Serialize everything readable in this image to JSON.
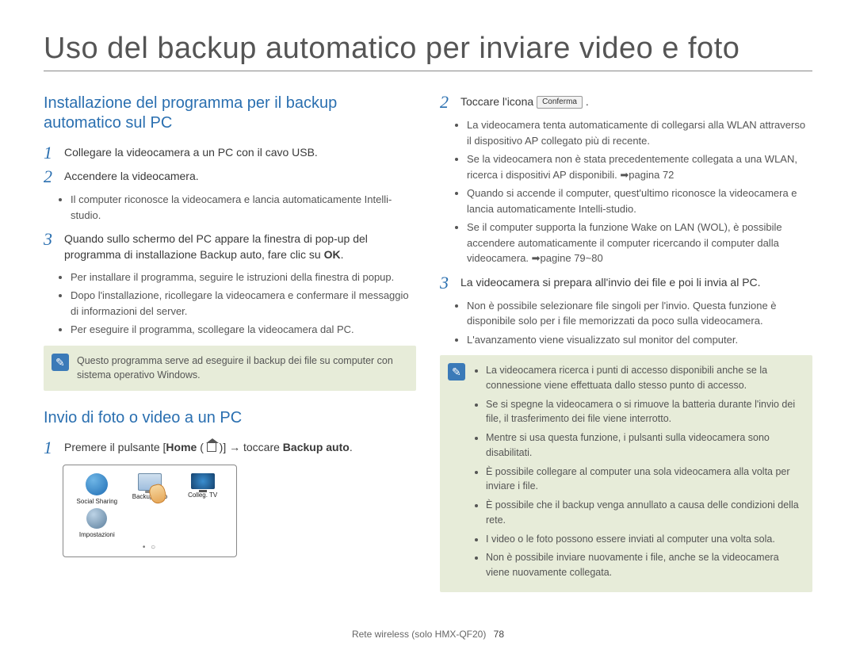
{
  "title": "Uso del backup automatico per inviare video e foto",
  "left": {
    "heading1": "Installazione del programma per il backup automatico sul PC",
    "step1": "Collegare la videocamera a un PC con il cavo USB.",
    "step2": "Accendere la videocamera.",
    "step2_sub1": "Il computer riconosce la videocamera e lancia automaticamente Intelli-studio.",
    "step3_a": "Quando sullo schermo del PC appare la finestra di pop-up del programma di installazione Backup auto, fare clic su ",
    "step3_b": "OK",
    "step3_c": ".",
    "step3_sub1": "Per installare il programma, seguire le istruzioni della finestra di popup.",
    "step3_sub2": "Dopo l'installazione, ricollegare la videocamera e confermare il messaggio di informazioni del server.",
    "step3_sub3": "Per eseguire il programma, scollegare la videocamera dal PC.",
    "note1": "Questo programma serve ad eseguire il backup dei file su computer con sistema operativo Windows.",
    "heading2": "Invio di foto o video a un PC",
    "send_step1_a": "Premere il pulsante [",
    "send_step1_home": "Home",
    "send_step1_b": " ( ",
    "send_step1_c": " )] → toccare ",
    "send_step1_backup": "Backup auto",
    "send_step1_d": ".",
    "screen": {
      "social": "Social Sharing",
      "backup": "Backup auto",
      "tv": "Colleg. TV",
      "settings": "Impostazioni"
    }
  },
  "right": {
    "step2_a": "Toccare l'icona ",
    "step2_btn": "Conferma",
    "step2_b": " .",
    "step2_sub1": "La videocamera tenta automaticamente di collegarsi alla WLAN attraverso il dispositivo AP collegato più di recente.",
    "step2_sub2": "Se la videocamera non è stata precedentemente collegata a una WLAN, ricerca i dispositivi AP disponibili. ➡pagina 72",
    "step2_sub3": "Quando si accende il computer, quest'ultimo riconosce la videocamera e lancia automaticamente Intelli-studio.",
    "step2_sub4": "Se il computer supporta la funzione Wake on LAN (WOL), è possibile accendere automaticamente il computer ricercando il computer dalla videocamera. ➡pagine 79~80",
    "step3": "La videocamera si prepara all'invio dei file e poi li invia al PC.",
    "step3_sub1": "Non è possibile selezionare file singoli per l'invio. Questa funzione è disponibile solo per i file memorizzati da poco sulla videocamera.",
    "step3_sub2": "L'avanzamento viene visualizzato sul monitor del computer.",
    "note_items": [
      "La videocamera ricerca i punti di accesso disponibili anche se la connessione viene effettuata dallo stesso punto di accesso.",
      "Se si spegne la videocamera o si rimuove la batteria durante l'invio dei file, il trasferimento dei file viene interrotto.",
      "Mentre si usa questa funzione, i pulsanti sulla videocamera sono disabilitati.",
      "È possibile collegare al computer una sola videocamera alla volta per inviare i file.",
      "È possibile che il backup venga annullato a causa delle condizioni della rete.",
      "I video o le foto possono essere inviati al computer una volta sola.",
      "Non è possibile inviare nuovamente i file, anche se la videocamera viene nuovamente collegata."
    ]
  },
  "footer": {
    "section": "Rete wireless (solo HMX-QF20)",
    "page": "78"
  }
}
